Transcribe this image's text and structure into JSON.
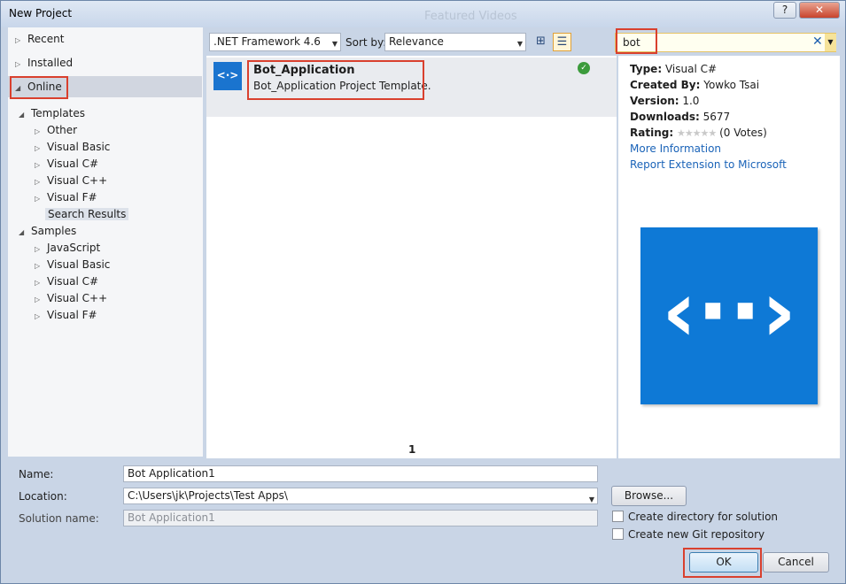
{
  "window": {
    "title": "New Project",
    "ghost_title": "Featured Videos",
    "help_label": "?",
    "close_label": "✕"
  },
  "sidebar": {
    "recent": "Recent",
    "installed": "Installed",
    "online": "Online",
    "templates": {
      "label": "Templates",
      "items": [
        "Other",
        "Visual Basic",
        "Visual C#",
        "Visual C++",
        "Visual F#"
      ],
      "selected": "Search Results"
    },
    "samples": {
      "label": "Samples",
      "items": [
        "JavaScript",
        "Visual Basic",
        "Visual C#",
        "Visual C++",
        "Visual F#"
      ]
    }
  },
  "toolbar": {
    "framework": ".NET Framework 4.6",
    "sort_label": "Sort by:",
    "sort_value": "Relevance"
  },
  "search": {
    "value": "bot",
    "clear_icon": "✕"
  },
  "template": {
    "name": "Bot_Application",
    "description": "Bot_Application Project Template.",
    "icon_glyph": "<·>",
    "installed_icon": "✓"
  },
  "pager": {
    "page": "1"
  },
  "details": {
    "type_label": "Type:",
    "type_value": "Visual C#",
    "created_label": "Created By:",
    "created_value": "Yowko Tsai",
    "version_label": "Version:",
    "version_value": "1.0",
    "downloads_label": "Downloads:",
    "downloads_value": "5677",
    "rating_label": "Rating:",
    "rating_stars": "★★★★★",
    "rating_value": "(0 Votes)",
    "more_info": "More Information",
    "report": "Report Extension to Microsoft",
    "big_icon_glyph": "‹··›"
  },
  "form": {
    "name_label": "Name:",
    "name_value": "Bot Application1",
    "location_label": "Location:",
    "location_value": "C:\\Users\\jk\\Projects\\Test Apps\\",
    "solution_label": "Solution name:",
    "solution_value": "Bot Application1",
    "browse": "Browse...",
    "create_dir": "Create directory for solution",
    "create_git": "Create new Git repository",
    "ok": "OK",
    "cancel": "Cancel"
  },
  "colors": {
    "accent": "#1a74cf",
    "highlight": "#d9402e",
    "link": "#1a63b8"
  }
}
